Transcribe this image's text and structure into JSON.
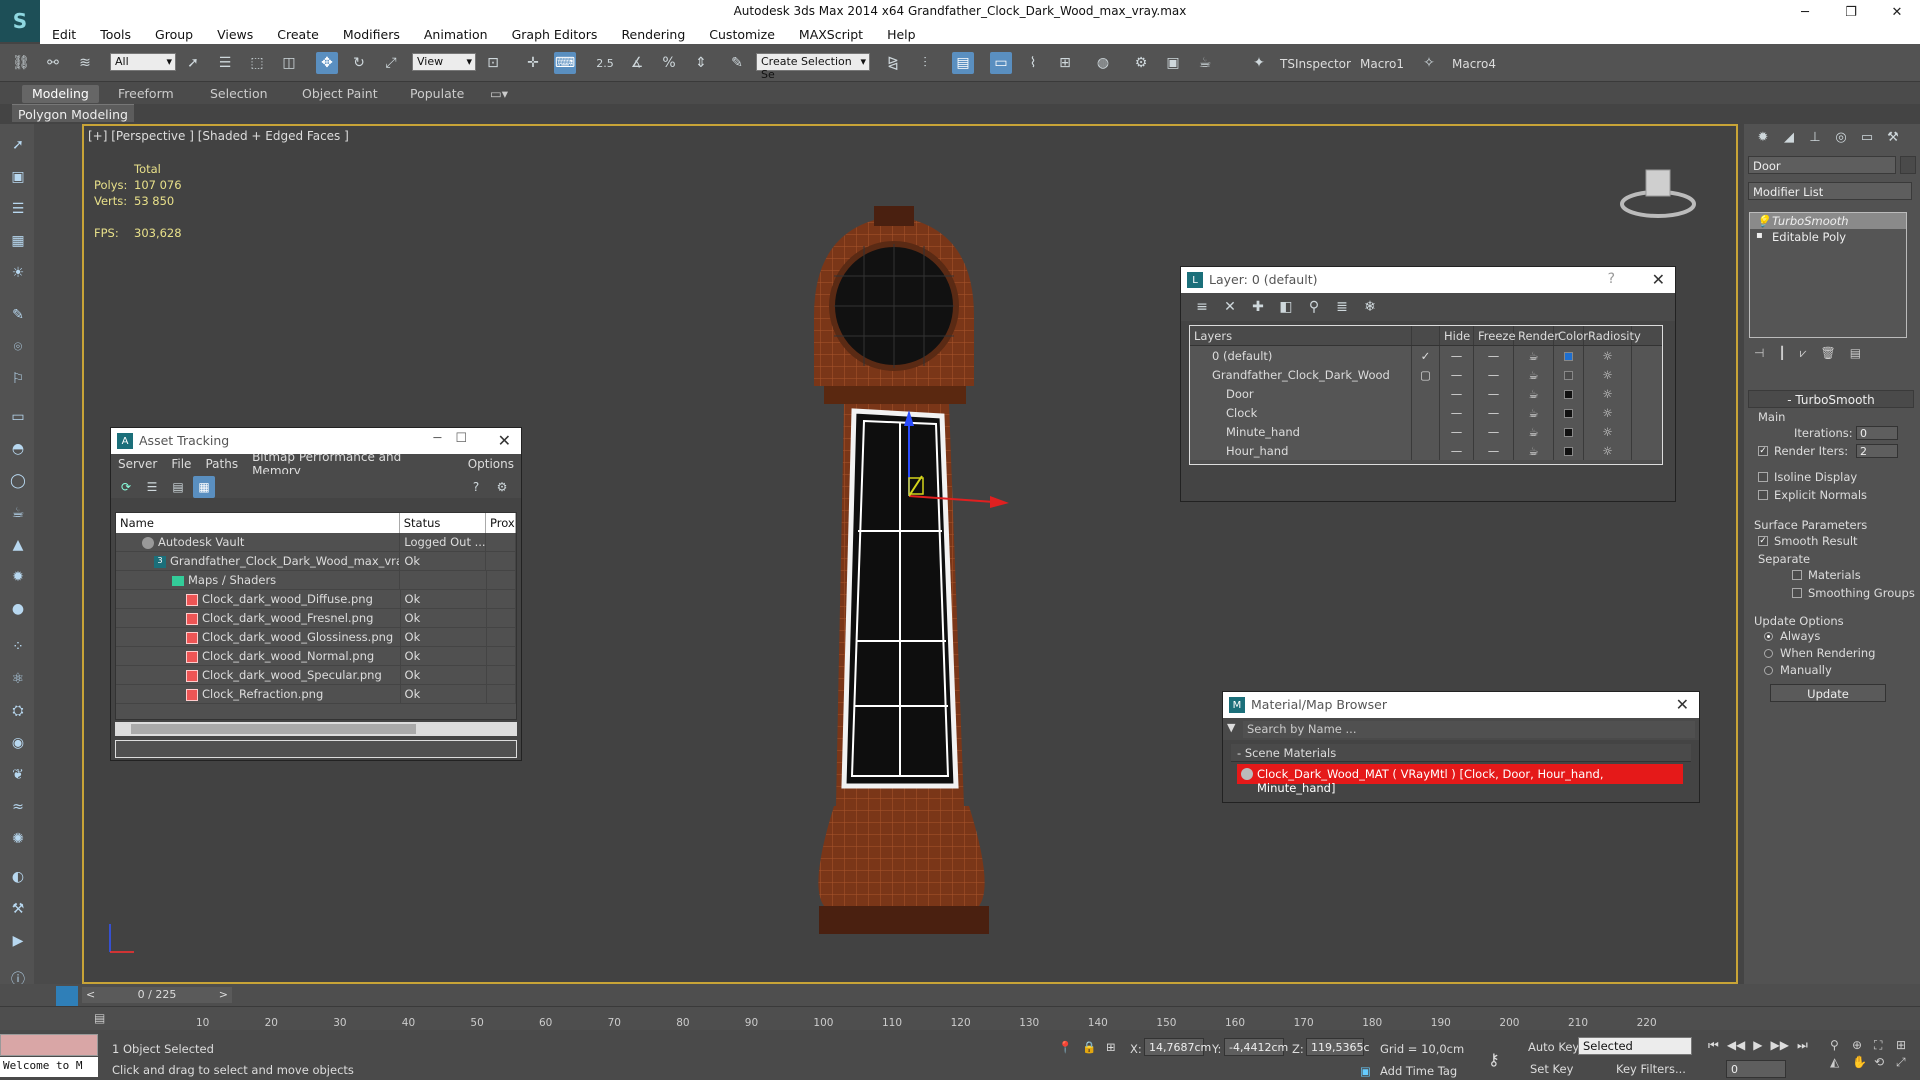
{
  "app": {
    "title": "Autodesk 3ds Max  2014 x64    Grandfather_Clock_Dark_Wood_max_vray.max"
  },
  "menu": [
    "Edit",
    "Tools",
    "Group",
    "Views",
    "Create",
    "Modifiers",
    "Animation",
    "Graph Editors",
    "Rendering",
    "Customize",
    "MAXScript",
    "Help"
  ],
  "toolbar": {
    "selection_filter": "All",
    "ref_coord": "View",
    "snap_value": "2.5",
    "named_selection_placeholder": "Create Selection Se",
    "scripts": [
      "TSInspector",
      "Macro1",
      "Macro4"
    ]
  },
  "ribbon": {
    "tabs": [
      "Modeling",
      "Freeform",
      "Selection",
      "Object Paint",
      "Populate"
    ],
    "active_tab": "Modeling",
    "subpanel": "Polygon Modeling"
  },
  "viewport": {
    "label": "[+] [Perspective ] [Shaded + Edged Faces ]",
    "stats_header": "Total",
    "polys_label": "Polys:",
    "polys_value": "107 076",
    "verts_label": "Verts:",
    "verts_value": "53 850",
    "fps_label": "FPS:",
    "fps_value": "303,628"
  },
  "asset_tracking": {
    "title": "Asset Tracking",
    "menu": [
      "Server",
      "File",
      "Paths",
      "Bitmap Performance and Memory",
      "Options"
    ],
    "columns": [
      "Name",
      "Status",
      "Prox"
    ],
    "rows": [
      {
        "name": "Autodesk Vault",
        "status": "Logged Out ...",
        "type": "vault"
      },
      {
        "name": "Grandfather_Clock_Dark_Wood_max_vra...",
        "status": "Ok",
        "type": "max"
      },
      {
        "name": "Maps / Shaders",
        "status": "",
        "type": "folder"
      },
      {
        "name": "Clock_dark_wood_Diffuse.png",
        "status": "Ok",
        "type": "png"
      },
      {
        "name": "Clock_dark_wood_Fresnel.png",
        "status": "Ok",
        "type": "png"
      },
      {
        "name": "Clock_dark_wood_Glossiness.png",
        "status": "Ok",
        "type": "png"
      },
      {
        "name": "Clock_dark_wood_Normal.png",
        "status": "Ok",
        "type": "png"
      },
      {
        "name": "Clock_dark_wood_Specular.png",
        "status": "Ok",
        "type": "png"
      },
      {
        "name": "Clock_Refraction.png",
        "status": "Ok",
        "type": "png"
      }
    ]
  },
  "layers": {
    "title": "Layer: 0 (default)",
    "columns": [
      "Layers",
      "Hide",
      "Freeze",
      "Render",
      "Color",
      "Radiosity"
    ],
    "rows": [
      {
        "name": "0 (default)",
        "check": "✓",
        "color": "#1e6fd0"
      },
      {
        "name": "Grandfather_Clock_Dark_Wood",
        "check": "▢",
        "color": "#4a4a4a"
      },
      {
        "name": "Door",
        "check": "",
        "color": "#111111"
      },
      {
        "name": "Clock",
        "check": "",
        "color": "#111111"
      },
      {
        "name": "Minute_hand",
        "check": "",
        "color": "#111111"
      },
      {
        "name": "Hour_hand",
        "check": "",
        "color": "#111111"
      }
    ]
  },
  "material_browser": {
    "title": "Material/Map Browser",
    "search_placeholder": "Search by Name ...",
    "section": "Scene Materials",
    "item": "Clock_Dark_Wood_MAT  ( VRayMtl )  [Clock, Door, Hour_hand, Minute_hand]"
  },
  "command_panel": {
    "object_name": "Door",
    "modifier_list": "Modifier List",
    "stack": [
      "TurboSmooth",
      "Editable Poly"
    ],
    "rollout_title": "TurboSmooth",
    "main_label": "Main",
    "iterations_label": "Iterations:",
    "iterations_value": "0",
    "render_iters_label": "Render Iters:",
    "render_iters_value": "2",
    "isoline_label": "Isoline Display",
    "explicit_normals_label": "Explicit Normals",
    "surface_params_label": "Surface Parameters",
    "smooth_result_label": "Smooth Result",
    "separate_label": "Separate",
    "materials_label": "Materials",
    "smoothing_groups_label": "Smoothing Groups",
    "update_options_label": "Update Options",
    "always_label": "Always",
    "when_rendering_label": "When Rendering",
    "manually_label": "Manually",
    "update_button": "Update"
  },
  "timeline": {
    "slider": "0 / 225",
    "ticks": [
      "10",
      "20",
      "30",
      "40",
      "50",
      "60",
      "70",
      "80",
      "90",
      "100",
      "110",
      "120",
      "130",
      "140",
      "150",
      "160",
      "170",
      "180",
      "190",
      "200",
      "210",
      "220"
    ]
  },
  "status": {
    "maxscript": "Welcome to M",
    "selected": "1 Object Selected",
    "prompt": "Click and drag to select and move objects",
    "x_label": "X:",
    "x_value": "14,7687cm",
    "y_label": "Y:",
    "y_value": "-4,4412cm",
    "z_label": "Z:",
    "z_value": "119,5365c",
    "grid": "Grid = 10,0cm",
    "add_time_tag": "Add Time Tag",
    "auto_key": "Auto Key",
    "set_key": "Set Key",
    "selected_dropdown": "Selected",
    "key_filters": "Key Filters...",
    "frame": "0"
  }
}
